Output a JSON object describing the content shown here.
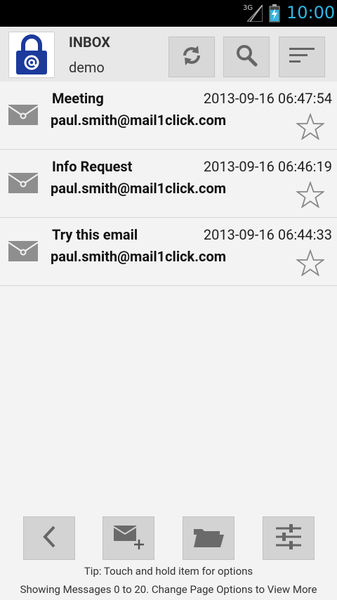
{
  "status_bar": {
    "network": "3G",
    "time": "10:00",
    "icons": [
      "signal-icon",
      "battery-charging-icon"
    ]
  },
  "action_bar": {
    "logo_icon": "lock-at-icon",
    "title": "INBOX",
    "subtitle": "demo",
    "buttons": [
      {
        "icon": "refresh-icon"
      },
      {
        "icon": "search-icon"
      },
      {
        "icon": "sort-icon"
      }
    ]
  },
  "messages": [
    {
      "subject": "Meeting",
      "date": "2013-09-16 06:47:54",
      "sender": "paul.smith@mail1click.com",
      "starred": false,
      "icon": "envelope-icon"
    },
    {
      "subject": "Info Request",
      "date": "2013-09-16 06:46:19",
      "sender": "paul.smith@mail1click.com",
      "starred": false,
      "icon": "envelope-icon"
    },
    {
      "subject": "Try this email",
      "date": "2013-09-16 06:44:33",
      "sender": "paul.smith@mail1click.com",
      "starred": false,
      "icon": "envelope-icon"
    }
  ],
  "bottom_bar": {
    "buttons": [
      {
        "icon": "back-arrow-icon"
      },
      {
        "icon": "compose-mail-icon"
      },
      {
        "icon": "folder-icon"
      },
      {
        "icon": "settings-sliders-icon"
      }
    ]
  },
  "footer": {
    "tip": "Tip: Touch and hold item for options",
    "showing": "Showing Messages 0 to 20. Change Page Options to View More"
  },
  "colors": {
    "accent": "#33b5e5",
    "logo_blue": "#1b3a9c"
  }
}
